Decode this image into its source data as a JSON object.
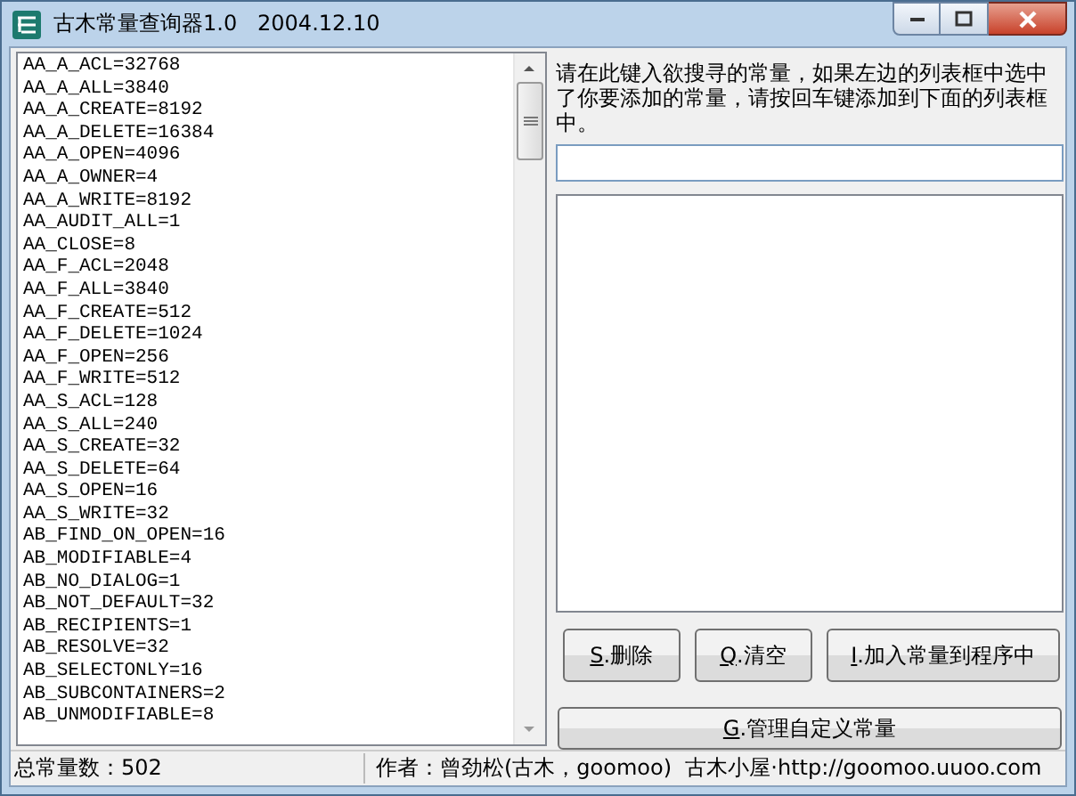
{
  "window": {
    "title": "古木常量查询器1.0   2004.12.10"
  },
  "constants_list": {
    "items": [
      "AA_A_ACL=32768",
      "AA_A_ALL=3840",
      "AA_A_CREATE=8192",
      "AA_A_DELETE=16384",
      "AA_A_OPEN=4096",
      "AA_A_OWNER=4",
      "AA_A_WRITE=8192",
      "AA_AUDIT_ALL=1",
      "AA_CLOSE=8",
      "AA_F_ACL=2048",
      "AA_F_ALL=3840",
      "AA_F_CREATE=512",
      "AA_F_DELETE=1024",
      "AA_F_OPEN=256",
      "AA_F_WRITE=512",
      "AA_S_ACL=128",
      "AA_S_ALL=240",
      "AA_S_CREATE=32",
      "AA_S_DELETE=64",
      "AA_S_OPEN=16",
      "AA_S_WRITE=32",
      "AB_FIND_ON_OPEN=16",
      "AB_MODIFIABLE=4",
      "AB_NO_DIALOG=1",
      "AB_NOT_DEFAULT=32",
      "AB_RECIPIENTS=1",
      "AB_RESOLVE=32",
      "AB_SELECTONLY=16",
      "AB_SUBCONTAINERS=2",
      "AB_UNMODIFIABLE=8"
    ]
  },
  "instructions": "请在此键入欲搜寻的常量，如果左边的列表框中选中了你要添加的常量，请按回车键添加到下面的列表框中。",
  "buttons": [
    {
      "text": "S.删除"
    },
    {
      "text": "Q.清空"
    },
    {
      "text": "I.加入常量到程序中"
    }
  ],
  "manage_button": {
    "text": "G.管理自定义常量"
  },
  "status_bar": [
    "总常量数：502",
    "作者：曾劲松(古木，goomoo)  古木小屋·http://goomoo.uuoo.com"
  ]
}
